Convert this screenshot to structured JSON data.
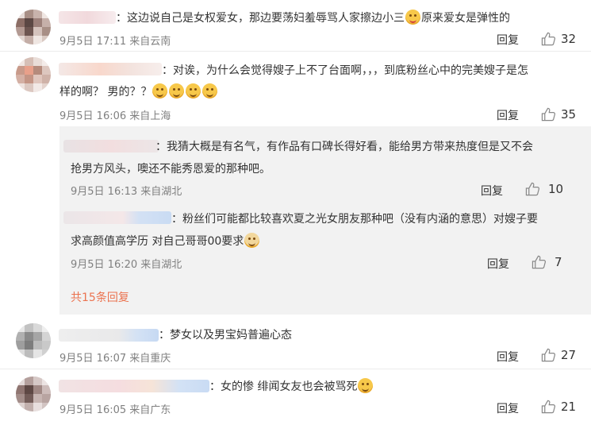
{
  "comments": [
    {
      "text_a": "：这边说自己是女权爱女，那边要荡妇羞辱骂人家擦边小三",
      "text_b": "原来爱女是弹性的",
      "meta": "9月5日 17:11 来自云南",
      "reply": "回复",
      "likes": "32"
    },
    {
      "line1": "：对诶，为什么会觉得嫂子上不了台面啊，，，到底粉丝心中的完美嫂子是怎",
      "line2": "样的啊？ 男的？？",
      "meta": "9月5日 16:06 来自上海",
      "reply": "回复",
      "likes": "35"
    },
    {
      "line1": "：梦女以及男宝妈普遍心态",
      "meta": "9月5日 16:07 来自重庆",
      "reply": "回复",
      "likes": "27"
    },
    {
      "line1": "：女的惨 绯闻女友也会被骂死",
      "meta": "9月5日 16:05 来自广东",
      "reply": "回复",
      "likes": "21"
    }
  ],
  "replies": [
    {
      "line1": "：我猜大概是有名气，有作品有口碑长得好看，能给男方带来热度但是又不会",
      "line2": "抢男方风头，噢还不能秀恩爱的那种吧。",
      "meta": "9月5日 16:13 来自湖北",
      "reply": "回复",
      "likes": "10"
    },
    {
      "line1": "：粉丝们可能都比较喜欢夏之光女朋友那种吧（没有内涵的意思）对嫂子要",
      "line2": "求高颜值高学历 对自己哥哥00要求",
      "meta": "9月5日 16:20 来自湖北",
      "reply": "回复",
      "likes": "7"
    }
  ],
  "more_replies": "共15条回复",
  "colors": {
    "meta": "#808080",
    "link": "#eb7350",
    "reply_bg": "#f2f2f2"
  },
  "icons": [
    "thumbs-up-icon",
    "emoji-icon"
  ]
}
